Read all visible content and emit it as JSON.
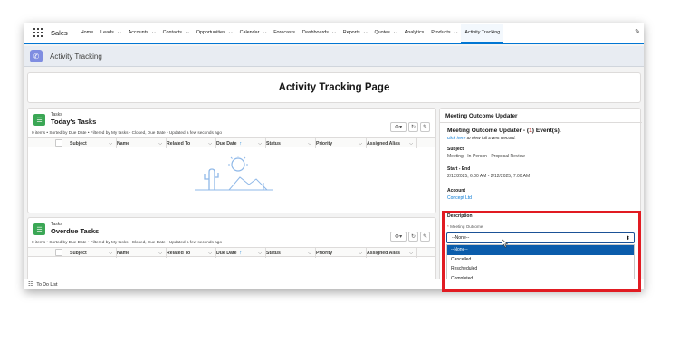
{
  "nav": {
    "app_name": "Sales",
    "items": [
      {
        "label": "Home",
        "chevron": false
      },
      {
        "label": "Leads",
        "chevron": true
      },
      {
        "label": "Accounts",
        "chevron": true
      },
      {
        "label": "Contacts",
        "chevron": true
      },
      {
        "label": "Opportunities",
        "chevron": true
      },
      {
        "label": "Calendar",
        "chevron": true
      },
      {
        "label": "Forecasts",
        "chevron": false
      },
      {
        "label": "Dashboards",
        "chevron": true
      },
      {
        "label": "Reports",
        "chevron": true
      },
      {
        "label": "Quotes",
        "chevron": true
      },
      {
        "label": "Analytics",
        "chevron": false
      },
      {
        "label": "Products",
        "chevron": true
      },
      {
        "label": "Activity Tracking",
        "chevron": false,
        "active": true
      }
    ]
  },
  "tab": {
    "title": "Activity Tracking"
  },
  "page": {
    "title": "Activity Tracking Page"
  },
  "today": {
    "sub": "Tasks",
    "title": "Today's Tasks",
    "meta": "0 items • Sorted by Due Date • Filtered by My tasks - Closed, Due Date • Updated a few seconds ago"
  },
  "overdue": {
    "sub": "Tasks",
    "title": "Overdue Tasks",
    "meta": "0 items • Sorted by Due Date • Filtered by My tasks - Closed, Due Date • Updated a few seconds ago"
  },
  "columns": [
    "Subject",
    "Name",
    "Related To",
    "Due Date",
    "Status",
    "Priority",
    "Assigned Alias"
  ],
  "panel": {
    "title": "Meeting Outcome Updater",
    "heading_prefix": "Meeting Outcome Updater - (",
    "heading_count": "1",
    "heading_suffix": ") Event(s).",
    "link_text": "click here",
    "link_rest": " to view full Event Record.",
    "subject_label": "Subject",
    "subject_value": "Meeting - In-Person - Proposal Review",
    "startend_label": "Start - End",
    "startend_value": "2/12/2025, 6:00 AM - 2/12/2025, 7:00 AM",
    "account_label": "Account",
    "account_value": "Concept Ltd",
    "description_label": "Description",
    "outcome_req": "*",
    "outcome_label": " Meeting Outcome",
    "selected": "--None--",
    "options": [
      "--None--",
      "Cancelled",
      "Rescheduled",
      "Completed"
    ]
  },
  "footer": {
    "label": "To Do List"
  },
  "colors": {
    "brand": "#0176d3",
    "task_icon": "#3ba755",
    "tab_icon": "#7f8de1",
    "highlight": "#e11b22",
    "selected_option": "#0b5cab"
  }
}
